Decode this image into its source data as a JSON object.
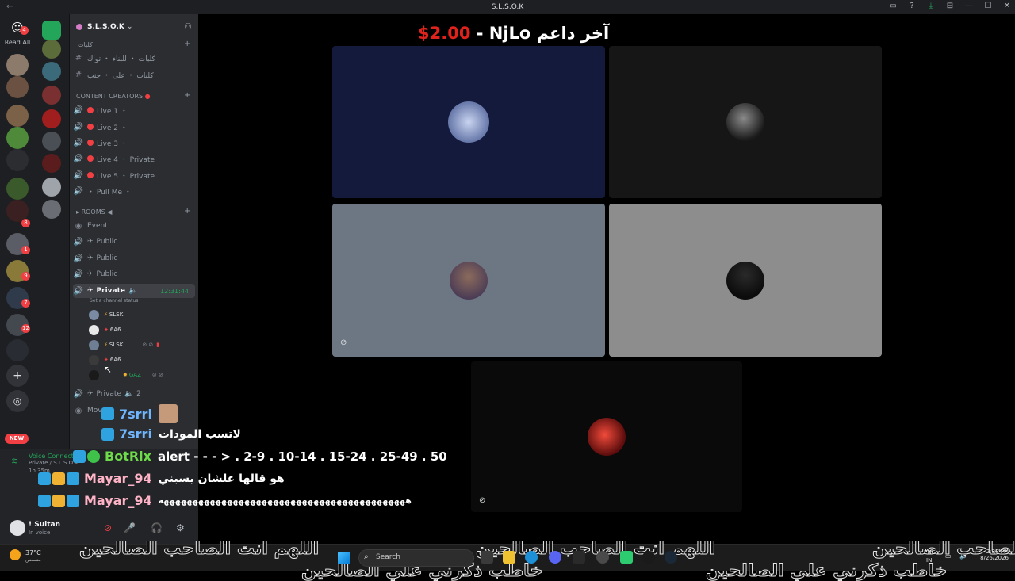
{
  "titlebar": {
    "title": "S.L.S.O.K",
    "back": "←",
    "controls": [
      "▭",
      "?",
      "⤓",
      "⊟",
      "—",
      "☐",
      "✕"
    ]
  },
  "guildbar": {
    "read_all": "Read All",
    "dm_badge": "4",
    "badges": [
      "8",
      "1",
      "9",
      "7",
      "12"
    ]
  },
  "server": {
    "name": "S.L.S.O.K",
    "categories": {
      "first": "كلبات",
      "content": "CONTENT CREATORS",
      "rooms": "ROOMS"
    },
    "text_channels": [
      "كلبات ・ للبناء ・ تواك",
      "كلبات ・ على ・ جنب"
    ],
    "live_channels": [
      "Live 1 ・",
      "Live 2 ・",
      "Live 3 ・",
      "Live 4 ・ Private",
      "Live 5 ・ Private",
      "・ Pull Me ・"
    ],
    "room_channels": [
      "Event",
      "Public",
      "Public",
      "Public"
    ],
    "active_channel": {
      "name": "Private",
      "timer": "12:31:44",
      "status": "Set a channel status"
    },
    "voice_users": [
      "SLSK",
      "6A6",
      "SLSK",
      "6A6",
      "GAZ"
    ],
    "next_channel": {
      "name": "Private",
      "count": "2"
    },
    "partial_channel": "Mov"
  },
  "new_pill": "NEW",
  "voice_panel": {
    "title": "Voice Connected",
    "sub": "Private / S.L.S.O.K",
    "time": "1h 35m"
  },
  "user_panel": {
    "name": "! Sultan",
    "status": "In voice"
  },
  "stage": {
    "donor_name": "NjLo",
    "donor_amount": "$2.00",
    "donor_label": "آخر داعم"
  },
  "chat_overlay": [
    {
      "name": "7srri",
      "message": "",
      "color": "#6fb6ff"
    },
    {
      "name": "7srri",
      "message": "لاتسب المودات",
      "color": "#6fb6ff"
    },
    {
      "name": "BotRix",
      "message": "alert - - - > . 2-9 . 10-14 . 15-24 . 25-49 . 50",
      "color": "#6ddb4a"
    },
    {
      "name": "Mayar_94",
      "message": "هو قالها علشان يسبني",
      "color": "#ffb3c7"
    },
    {
      "name": "Mayar_94",
      "message": "هههههههههههههههههههههههههههههههههههههههههههه",
      "color": "#ffb3c7"
    }
  ],
  "taskbar": {
    "temp": "37°C",
    "weather": "مشمس",
    "search": "Search",
    "lang": "ENG",
    "lang2": "IN",
    "time": "2:38 PM",
    "date": "8/26/2026"
  },
  "ticker": {
    "line1": "اللهم انت الصاحب  الصالحين",
    "line2": "خاطب ذكرني علي الصالحين"
  }
}
